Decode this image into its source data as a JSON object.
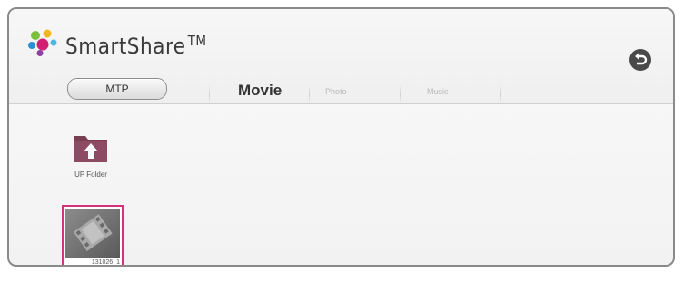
{
  "app": {
    "title": "SmartShare",
    "trademark": "TM"
  },
  "header": {
    "source_button": "MTP",
    "tabs": [
      {
        "label": "Movie",
        "active": true
      },
      {
        "label": "Photo",
        "active": false
      },
      {
        "label": "Music",
        "active": false
      }
    ],
    "back_icon": "back-arrow-icon"
  },
  "content": {
    "items": [
      {
        "label": "UP Folder",
        "icon": "up-folder-icon"
      },
      {
        "label": "131026_1",
        "icon": "movie-file-icon",
        "selected": true
      }
    ]
  },
  "colors": {
    "selection": "#d4327a",
    "folder": "#7a3d52"
  }
}
